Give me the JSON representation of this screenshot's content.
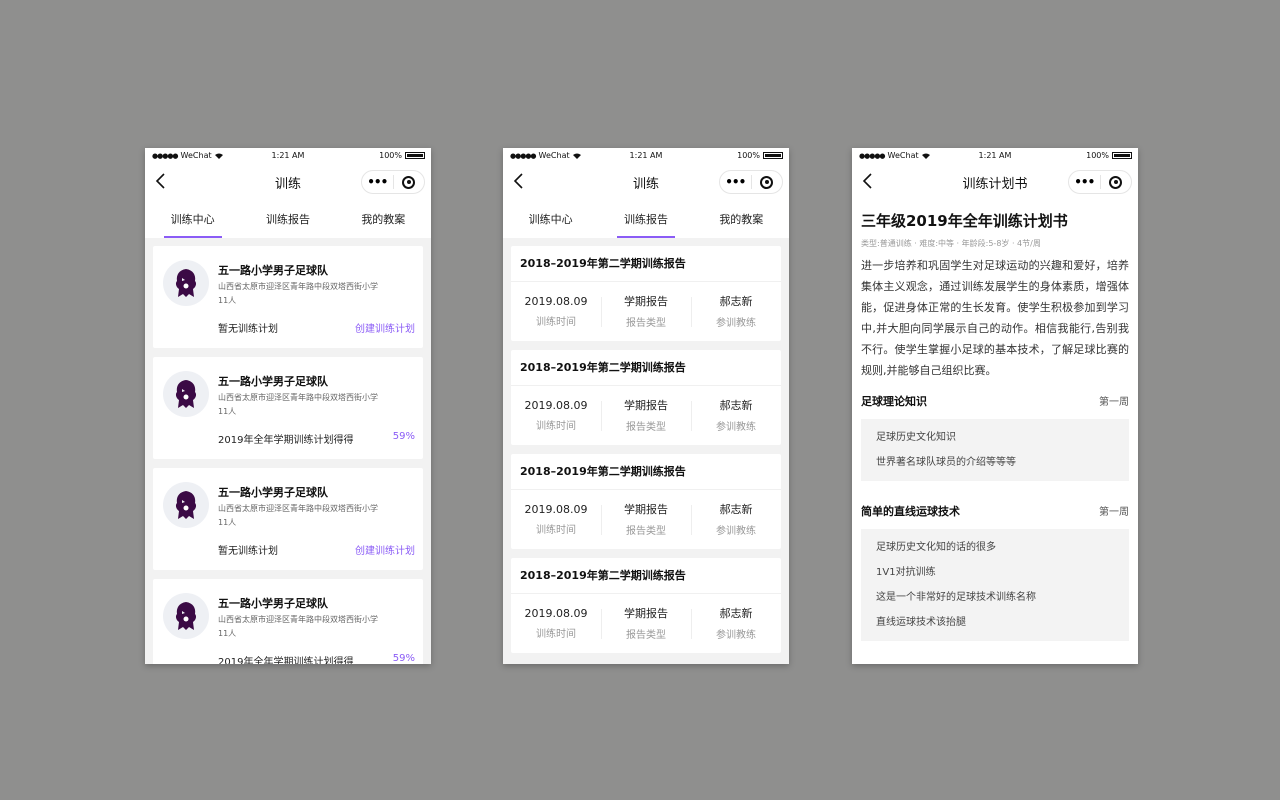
{
  "status": {
    "carrier": "WeChat",
    "time": "1:21 AM",
    "battery": "100%"
  },
  "colors": {
    "accent": "#8b5cf6",
    "background": "#8f8f8e",
    "logo": "#3b0a45"
  },
  "phone1": {
    "title": "训练",
    "tabs": [
      "训练中心",
      "训练报告",
      "我的教案"
    ],
    "cards": [
      {
        "name": "五一路小学男子足球队",
        "address": "山西省太原市迎泽区青年路中段双塔西街小学",
        "count": "11人",
        "plan": "暂无训练计划",
        "action": "创建训练计划"
      },
      {
        "name": "五一路小学男子足球队",
        "address": "山西省太原市迎泽区青年路中段双塔西街小学",
        "count": "11人",
        "plan": "2019年全年学期训练计划得得",
        "action": "59%"
      },
      {
        "name": "五一路小学男子足球队",
        "address": "山西省太原市迎泽区青年路中段双塔西街小学",
        "count": "11人",
        "plan": "暂无训练计划",
        "action": "创建训练计划"
      },
      {
        "name": "五一路小学男子足球队",
        "address": "山西省太原市迎泽区青年路中段双塔西街小学",
        "count": "11人",
        "plan": "2019年全年学期训练计划得得",
        "action": "59%"
      }
    ]
  },
  "phone2": {
    "title": "训练",
    "tabs": [
      "训练中心",
      "训练报告",
      "我的教案"
    ],
    "reports": [
      {
        "title": "2018–2019年第二学期训练报告",
        "date": "2019.08.09",
        "date_label": "训练时间",
        "type": "学期报告",
        "type_label": "报告类型",
        "coach": "郝志新",
        "coach_label": "参训教练"
      },
      {
        "title": "2018–2019年第二学期训练报告",
        "date": "2019.08.09",
        "date_label": "训练时间",
        "type": "学期报告",
        "type_label": "报告类型",
        "coach": "郝志新",
        "coach_label": "参训教练"
      },
      {
        "title": "2018–2019年第二学期训练报告",
        "date": "2019.08.09",
        "date_label": "训练时间",
        "type": "学期报告",
        "type_label": "报告类型",
        "coach": "郝志新",
        "coach_label": "参训教练"
      },
      {
        "title": "2018–2019年第二学期训练报告",
        "date": "2019.08.09",
        "date_label": "训练时间",
        "type": "学期报告",
        "type_label": "报告类型",
        "coach": "郝志新",
        "coach_label": "参训教练"
      }
    ]
  },
  "phone3": {
    "title": "训练计划书",
    "plan_title": "三年级2019年全年训练计划书",
    "meta": "类型:普通训练 · 难度:中等 · 年龄段:5-8岁 · 4节/周",
    "description": "进一步培养和巩固学生对足球运动的兴趣和爱好，培养集体主义观念，通过训练发展学生的身体素质，增强体能，促进身体正常的生长发育。使学生积极参加到学习中,并大胆向同学展示自己的动作。相信我能行,告别我不行。使学生掌握小足球的基本技术，了解足球比赛的规则,并能够自己组织比赛。",
    "sections": [
      {
        "title": "足球理论知识",
        "week": "第一周",
        "items": [
          "足球历史文化知识",
          "世界著名球队球员的介绍等等等"
        ]
      },
      {
        "title": "简单的直线运球技术",
        "week": "第一周",
        "items": [
          "足球历史文化知的话的很多",
          "1V1对抗训练",
          "这是一个非常好的足球技术训练名称",
          "直线运球技术该抬腿"
        ]
      }
    ]
  }
}
